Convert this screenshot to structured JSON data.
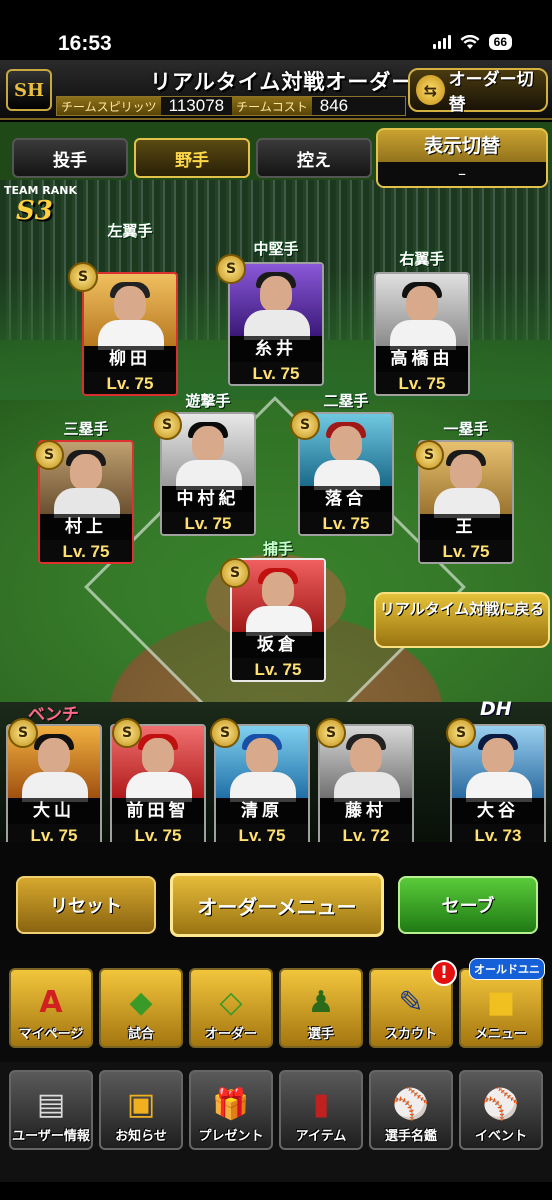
{
  "status": {
    "time": "16:53",
    "battery": "66"
  },
  "header": {
    "logo": "SH",
    "title": "リアルタイム対戦オーダー",
    "spirits_label": "チームスピリッツ",
    "spirits_value": "113078",
    "cost_label": "チームコスト",
    "cost_value": "846",
    "order_switch": "オーダー切替"
  },
  "tabs": [
    {
      "label": "投手"
    },
    {
      "label": "野手"
    },
    {
      "label": "控え"
    }
  ],
  "display_switch": {
    "title": "表示切替",
    "value": "–"
  },
  "team_rank": {
    "label": "TEAM RANK",
    "value": "S3"
  },
  "positions": {
    "lf": {
      "pos": "左翼手",
      "name": "柳田",
      "lv": "Lv. 75"
    },
    "cf": {
      "pos": "中堅手",
      "name": "糸井",
      "lv": "Lv. 75"
    },
    "rf": {
      "pos": "右翼手",
      "name": "高橋由",
      "lv": "Lv. 75"
    },
    "b3": {
      "pos": "三塁手",
      "name": "村上",
      "lv": "Lv. 75"
    },
    "ss": {
      "pos": "遊撃手",
      "name": "中村紀",
      "lv": "Lv. 75"
    },
    "b2": {
      "pos": "二塁手",
      "name": "落合",
      "lv": "Lv. 75"
    },
    "b1": {
      "pos": "一塁手",
      "name": "王",
      "lv": "Lv. 75"
    },
    "c": {
      "pos": "捕手",
      "name": "坂倉",
      "lv": "Lv. 75"
    }
  },
  "back_button": "リアルタイム対戦に戻る",
  "bench": {
    "label": "ベンチ",
    "dh_label": "DH",
    "players": [
      {
        "name": "大山",
        "lv": "Lv. 75"
      },
      {
        "name": "前田智",
        "lv": "Lv. 75"
      },
      {
        "name": "清原",
        "lv": "Lv. 75"
      },
      {
        "name": "藤村",
        "lv": "Lv. 72"
      },
      {
        "name": "大谷",
        "lv": "Lv. 73"
      }
    ]
  },
  "actions": {
    "reset": "リセット",
    "order_menu": "オーダーメニュー",
    "save": "セーブ"
  },
  "nav1": [
    {
      "label": "マイページ",
      "icon": "A"
    },
    {
      "label": "試合",
      "icon": "◆"
    },
    {
      "label": "オーダー",
      "icon": "◇"
    },
    {
      "label": "選手",
      "icon": "♟"
    },
    {
      "label": "スカウト",
      "icon": "✎",
      "alert": "!"
    },
    {
      "label": "メニュー",
      "icon": "■",
      "tag": "オールドユニ"
    }
  ],
  "nav2": [
    {
      "label": "ユーザー情報",
      "icon": "▤"
    },
    {
      "label": "お知らせ",
      "icon": "▣"
    },
    {
      "label": "プレゼント",
      "icon": "🎁"
    },
    {
      "label": "アイテム",
      "icon": "▮"
    },
    {
      "label": "選手名鑑",
      "icon": "⚾"
    },
    {
      "label": "イベント",
      "icon": "⚾"
    }
  ],
  "colors": {
    "gold": "#e2c24a",
    "green": "#3aa028",
    "alert": "#e41010"
  }
}
